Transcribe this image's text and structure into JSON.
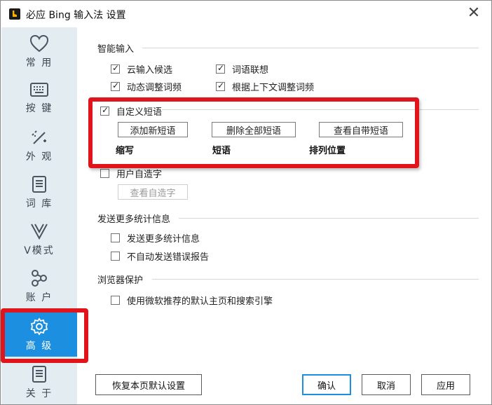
{
  "window": {
    "title": "必应 Bing 输入法 设置",
    "close_label": "✕"
  },
  "sidebar": {
    "items": [
      {
        "label": "常 用",
        "icon": "heart-icon"
      },
      {
        "label": "按 键",
        "icon": "keyboard-icon"
      },
      {
        "label": "外 观",
        "icon": "magic-wand-icon"
      },
      {
        "label": "词 库",
        "icon": "document-icon"
      },
      {
        "label": "V模式",
        "icon": "v-icon"
      },
      {
        "label": "账 户",
        "icon": "share-icon"
      },
      {
        "label": "高 级",
        "icon": "gear-icon",
        "active": true
      },
      {
        "label": "关 于",
        "icon": "info-document-icon"
      }
    ]
  },
  "smart_input": {
    "title": "智能输入",
    "options": [
      {
        "label": "云输入候选",
        "checked": true
      },
      {
        "label": "词语联想",
        "checked": true
      },
      {
        "label": "动态调整词频",
        "checked": true
      },
      {
        "label": "根据上下文调整词频",
        "checked": true
      }
    ]
  },
  "custom_phrase": {
    "label": "自定义短语",
    "checked": true,
    "add_button": "添加新短语",
    "delete_all_button": "删除全部短语",
    "view_builtin_button": "查看自带短语",
    "columns": [
      "缩写",
      "短语",
      "排列位置"
    ]
  },
  "user_chars": {
    "label": "用户自造字",
    "checked": false,
    "view_button": "查看自造字"
  },
  "statistics": {
    "title": "发送更多统计信息",
    "options": [
      {
        "label": "发送更多统计信息",
        "checked": false
      },
      {
        "label": "不自动发送错误报告",
        "checked": false
      }
    ]
  },
  "browser": {
    "title": "浏览器保护",
    "options": [
      {
        "label": "使用微软推荐的默认主页和搜索引擎",
        "checked": false
      }
    ]
  },
  "footer": {
    "restore_button": "恢复本页默认设置",
    "ok_button": "确认",
    "cancel_button": "取消",
    "apply_button": "应用"
  },
  "colors": {
    "sidebar_bg": "#e2ecf1",
    "active_nav": "#1d8fe1",
    "highlight_red": "#e0151c"
  }
}
